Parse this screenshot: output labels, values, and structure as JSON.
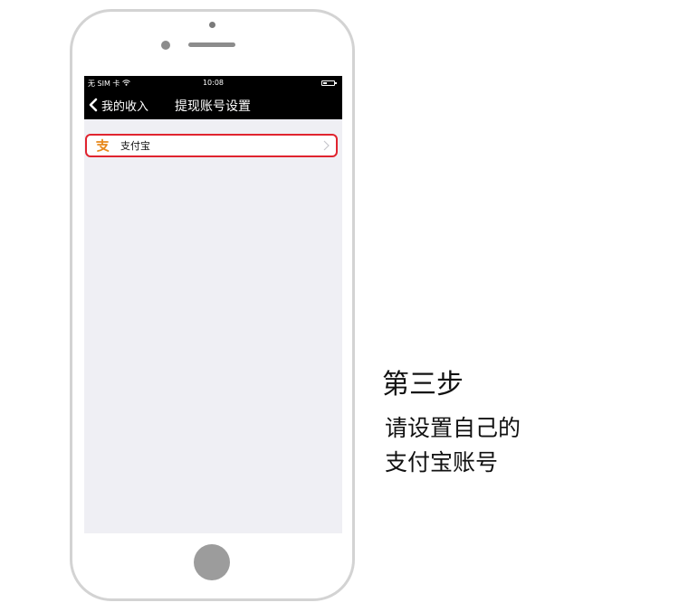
{
  "status_bar": {
    "carrier": "无 SIM 卡 ",
    "time": "10:08",
    "wifi_icon": "wifi-icon",
    "battery_icon": "battery-icon"
  },
  "nav": {
    "back_label": "我的收入",
    "back_icon": "chevron-left-icon",
    "title": "提现账号设置"
  },
  "accounts": [
    {
      "label": "支付宝",
      "icon": "alipay-icon",
      "chevron_icon": "chevron-right-icon"
    }
  ],
  "instruction": {
    "step": "第三步",
    "lines": [
      "请设置自己的",
      "支付宝账号"
    ]
  },
  "colors": {
    "nav_background": "#000000",
    "screen_background": "#efeff4",
    "highlight_border": "#e0242f",
    "phone_frame": "#d3d3d3",
    "alipay_brand": "#e8891c"
  }
}
